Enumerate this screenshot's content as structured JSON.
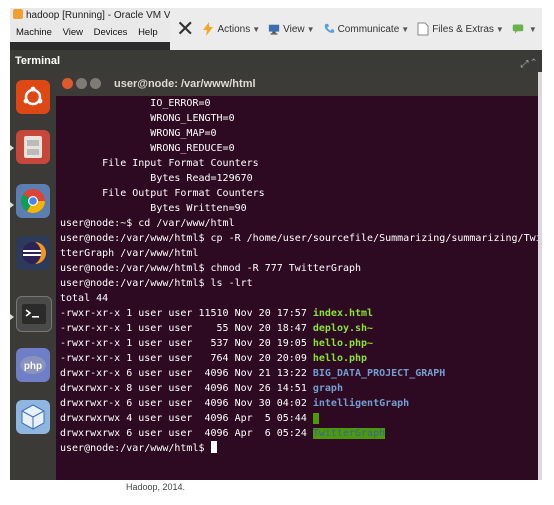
{
  "vbox": {
    "window_title": "hadoop [Running] - Oracle VM Virtu",
    "menu": [
      "Machine",
      "View",
      "Devices",
      "Help"
    ],
    "toolbar": [
      {
        "label": "Actions",
        "icon": "lightning-icon",
        "color": "#f5a623"
      },
      {
        "label": "View",
        "icon": "monitor-icon",
        "color": "#3a6fb0"
      },
      {
        "label": "Communicate",
        "icon": "phone-icon",
        "color": "#5aa0d8"
      },
      {
        "label": "Files & Extras",
        "icon": "file-icon",
        "color": "#888888"
      }
    ]
  },
  "header": {
    "title": "Terminal"
  },
  "terminal": {
    "title": "user@node: /var/www/html",
    "lines": [
      [
        {
          "t": "               IO_ERROR=0"
        }
      ],
      [
        {
          "t": "               WRONG_LENGTH=0"
        }
      ],
      [
        {
          "t": "               WRONG_MAP=0"
        }
      ],
      [
        {
          "t": "               WRONG_REDUCE=0"
        }
      ],
      [
        {
          "t": "       File Input Format Counters"
        }
      ],
      [
        {
          "t": "               Bytes Read=129670"
        }
      ],
      [
        {
          "t": "       File Output Format Counters"
        }
      ],
      [
        {
          "t": "               Bytes Written=90"
        }
      ],
      [
        {
          "t": "user@node:~$ cd /var/www/html"
        }
      ],
      [
        {
          "t": "user@node:/var/www/html$ cp -R /home/user/sourcefile/Summarizing/summarizing/Twi"
        }
      ],
      [
        {
          "t": "tterGraph /var/www/html"
        }
      ],
      [
        {
          "t": "user@node:/var/www/html$ chmod -R 777 TwitterGraph"
        }
      ],
      [
        {
          "t": "user@node:/var/www/html$ ls -lrt"
        }
      ],
      [
        {
          "t": "total 44"
        }
      ],
      [
        {
          "t": "-rwxr-xr-x 1 user user 11510 Nov 20 17:57 "
        },
        {
          "t": "index.html",
          "c": "exec"
        }
      ],
      [
        {
          "t": "-rwxr-xr-x 1 user user    55 Nov 20 18:47 "
        },
        {
          "t": "deploy.sh~",
          "c": "exec"
        }
      ],
      [
        {
          "t": "-rwxr-xr-x 1 user user   537 Nov 20 19:05 "
        },
        {
          "t": "hello.php~",
          "c": "exec"
        }
      ],
      [
        {
          "t": "-rwxr-xr-x 1 user user   764 Nov 20 20:09 "
        },
        {
          "t": "hello.php",
          "c": "exec"
        }
      ],
      [
        {
          "t": "drwxr-xr-x 6 user user  4096 Nov 21 13:22 "
        },
        {
          "t": "BIG_DATA_PROJECT_GRAPH",
          "c": "dir"
        }
      ],
      [
        {
          "t": "drwxrwxr-x 8 user user  4096 Nov 26 14:51 "
        },
        {
          "t": "graph",
          "c": "dir"
        }
      ],
      [
        {
          "t": "drwxrwxr-x 6 user user  4096 Nov 30 04:02 "
        },
        {
          "t": "intelligentGraph",
          "c": "dir"
        }
      ],
      [
        {
          "t": "drwxrwxrwx 4 user user  4096 Apr  5 05:44 "
        },
        {
          "t": " ",
          "c": "otw"
        }
      ],
      [
        {
          "t": "drwxrwxrwx 6 user user  4096 Apr  6 05:24 "
        },
        {
          "t": "TwitterGraph",
          "c": "otw"
        }
      ],
      [
        {
          "t": "user@node:/var/www/html$ "
        },
        {
          "cursor": true
        }
      ]
    ]
  },
  "caption": "Hadoop, 2014."
}
